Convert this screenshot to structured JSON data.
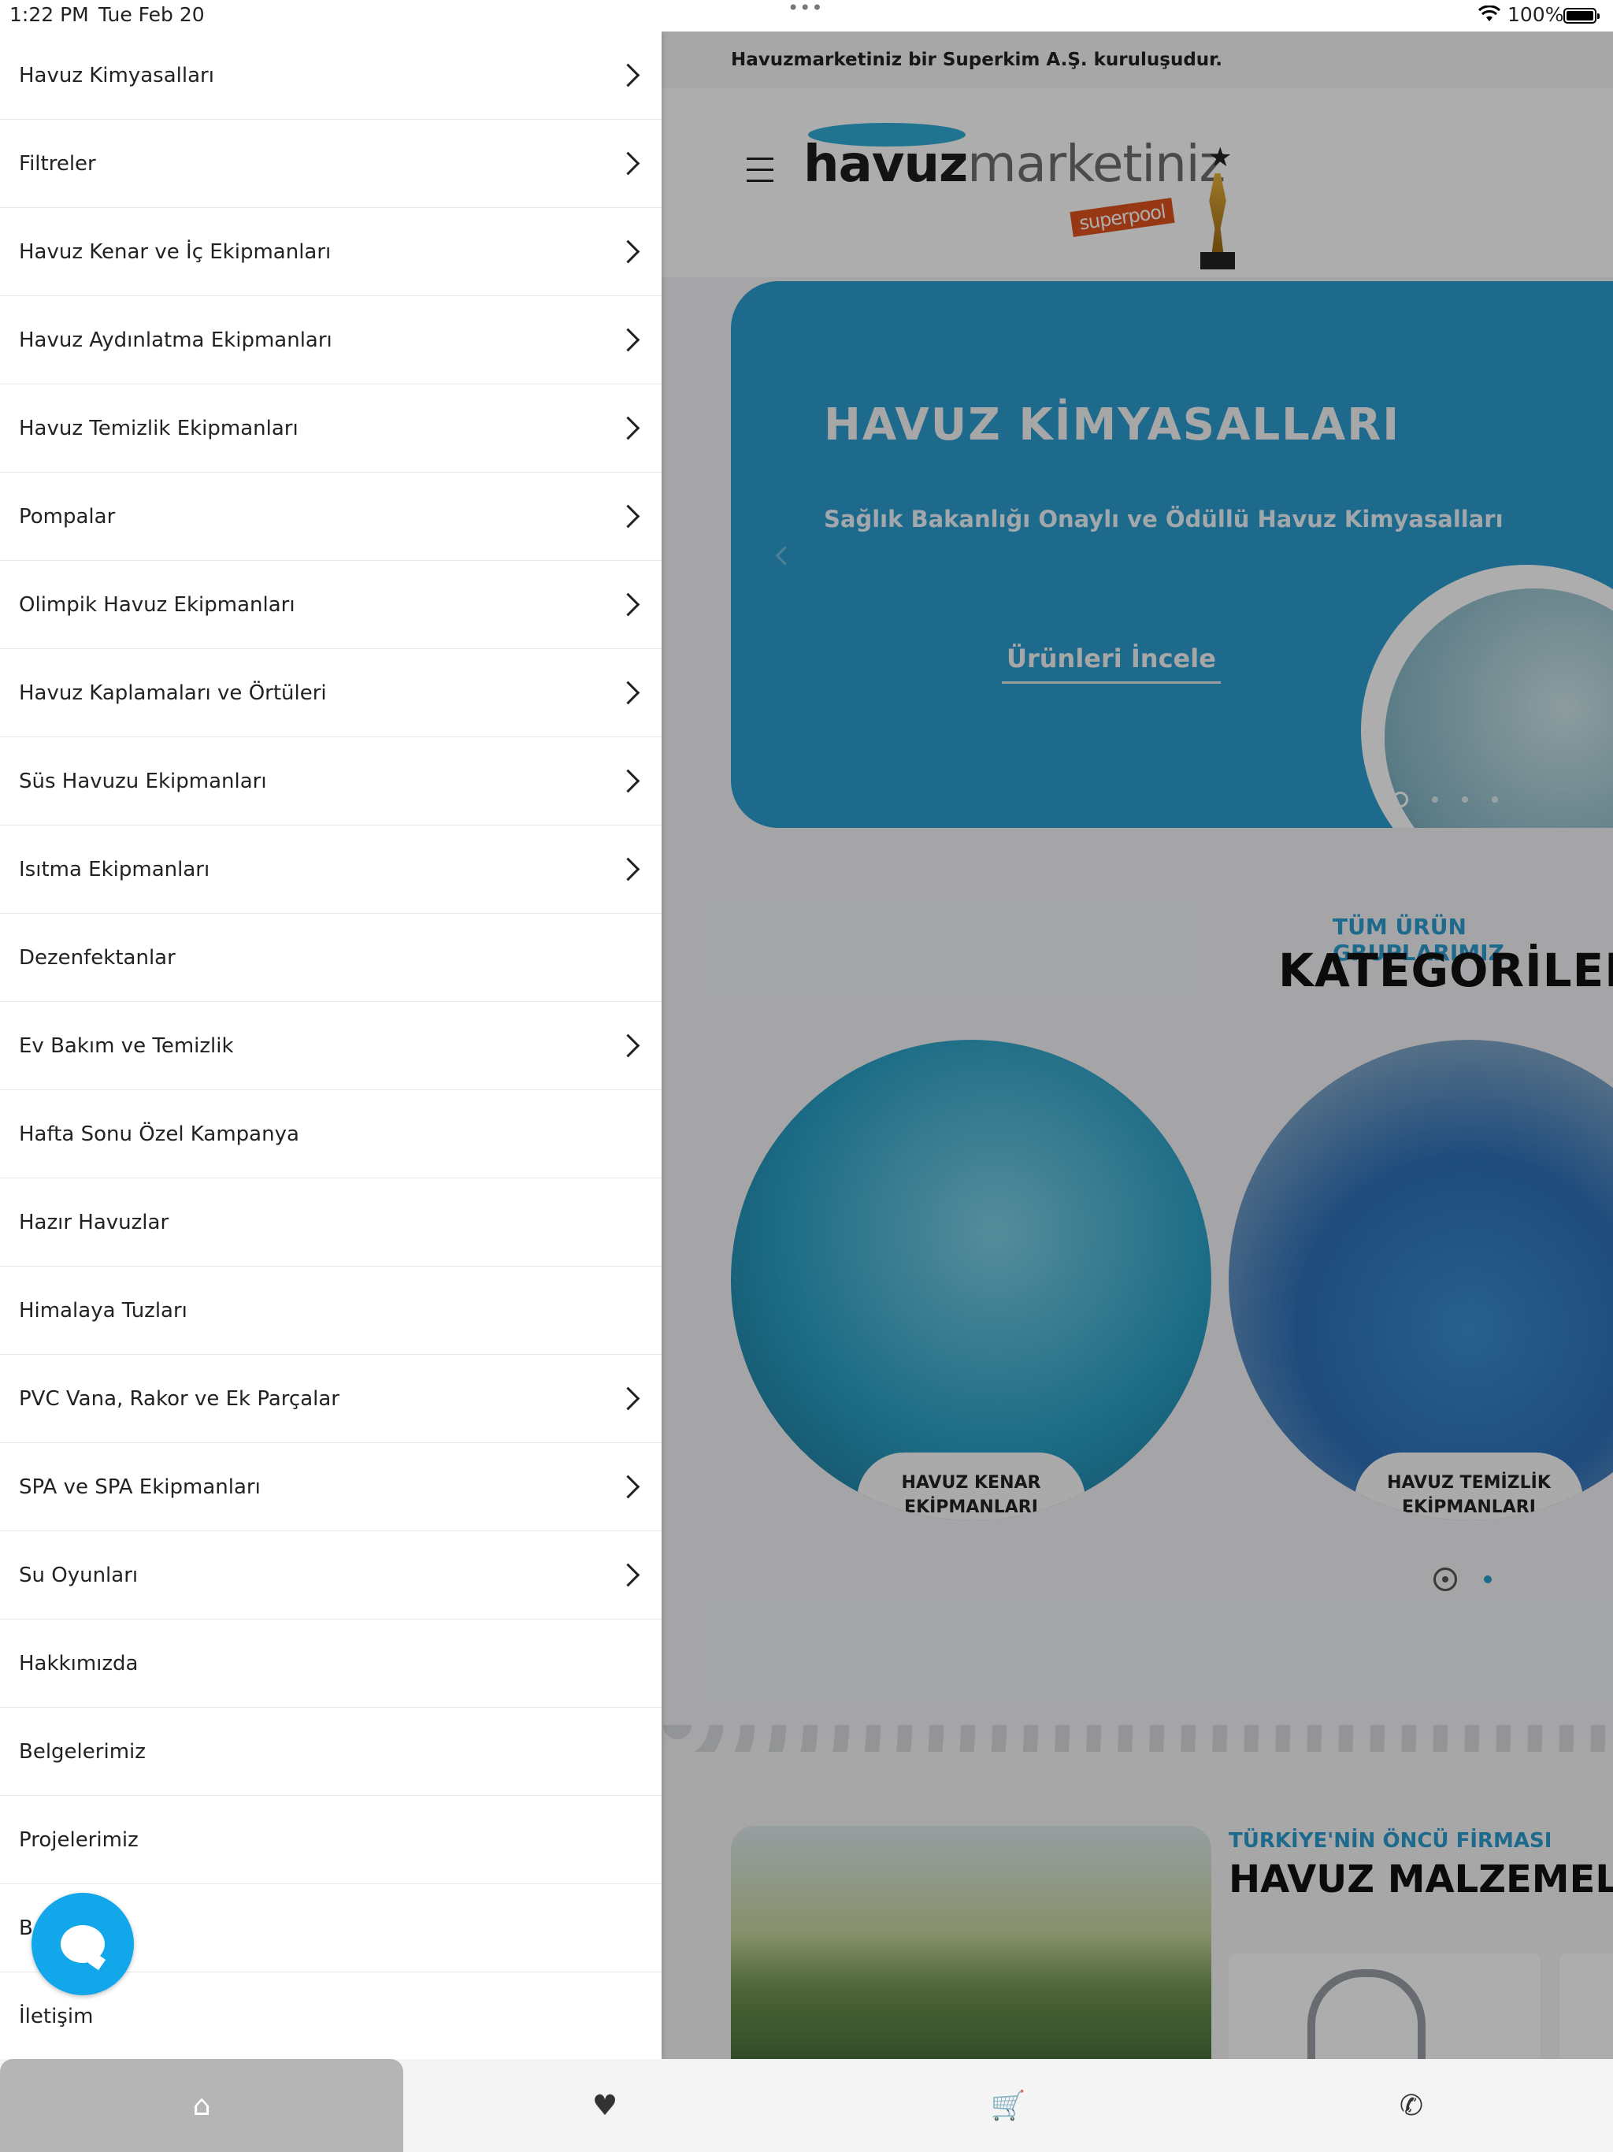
{
  "status": {
    "time": "1:22 PM",
    "date": "Tue Feb 20",
    "battery": "100%",
    "wifi_icon": "wifi-icon"
  },
  "menu": [
    {
      "label": "Havuz Kimyasalları",
      "has_children": true
    },
    {
      "label": "Filtreler",
      "has_children": true
    },
    {
      "label": "Havuz Kenar ve İç Ekipmanları",
      "has_children": true
    },
    {
      "label": "Havuz Aydınlatma Ekipmanları",
      "has_children": true
    },
    {
      "label": "Havuz Temizlik Ekipmanları",
      "has_children": true
    },
    {
      "label": "Pompalar",
      "has_children": true
    },
    {
      "label": "Olimpik Havuz Ekipmanları",
      "has_children": true
    },
    {
      "label": "Havuz Kaplamaları ve Örtüleri",
      "has_children": true
    },
    {
      "label": "Süs Havuzu Ekipmanları",
      "has_children": true
    },
    {
      "label": "Isıtma Ekipmanları",
      "has_children": true
    },
    {
      "label": "Dezenfektanlar",
      "has_children": false
    },
    {
      "label": "Ev Bakım ve Temizlik",
      "has_children": true
    },
    {
      "label": "Hafta Sonu Özel Kampanya",
      "has_children": false
    },
    {
      "label": "Hazır Havuzlar",
      "has_children": false
    },
    {
      "label": "Himalaya Tuzları",
      "has_children": false
    },
    {
      "label": "PVC Vana, Rakor ve Ek Parçalar",
      "has_children": true
    },
    {
      "label": "SPA ve SPA Ekipmanları",
      "has_children": true
    },
    {
      "label": "Su Oyunları",
      "has_children": true
    },
    {
      "label": "Hakkımızda",
      "has_children": false
    },
    {
      "label": "Belgelerimiz",
      "has_children": false
    },
    {
      "label": "Projelerimiz",
      "has_children": false
    },
    {
      "label": "B",
      "has_children": false
    },
    {
      "label": "İletişim",
      "has_children": false
    }
  ],
  "page": {
    "announcement": "Havuzmarketiniz bir Superkim A.Ş. kuruluşudur.",
    "logo": {
      "bold": "havuz",
      "light": "marketiniz",
      "tag": "superpool"
    },
    "banner": {
      "title": "HAVUZ KİMYASALLARI",
      "subtitle": "Sağlık Bakanlığı Onaylı ve Ödüllü Havuz Kimyasalları",
      "cta": "Ürünleri İncele"
    },
    "categories": {
      "eyebrow": "TÜM ÜRÜN GRUPLARIMIZ",
      "title": "KATEGORİLERİM",
      "items": [
        {
          "line1": "HAVUZ KENAR",
          "line2": "EKİPMANLARI"
        },
        {
          "line1": "HAVUZ TEMİZLİK",
          "line2": "EKİPMANLARI"
        }
      ]
    },
    "lower": {
      "eyebrow": "TÜRKİYE'NİN ÖNCÜ FİRMASI",
      "title": "HAVUZ MALZEMELER"
    }
  },
  "tabbar": [
    {
      "name": "home",
      "icon": "home-icon",
      "glyph": "⌂"
    },
    {
      "name": "favorites",
      "icon": "heart-icon",
      "glyph": "♥"
    },
    {
      "name": "cart",
      "icon": "cart-icon",
      "glyph": "🛒"
    },
    {
      "name": "whatsapp",
      "icon": "whatsapp-icon",
      "glyph": "✆"
    }
  ],
  "colors": {
    "accent": "#2b9cd0",
    "fab": "#12a6ea",
    "logo_tag": "#e0521c"
  }
}
